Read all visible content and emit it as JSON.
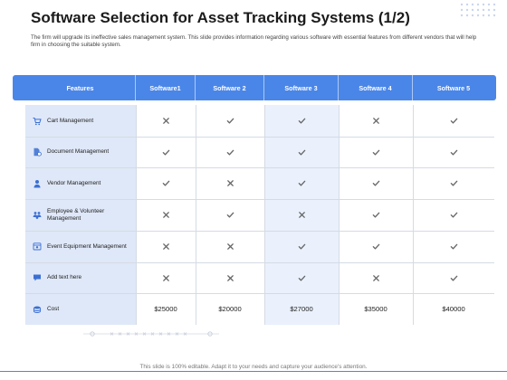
{
  "slide": {
    "title": "Software Selection for Asset Tracking Systems (1/2)",
    "subtitle": "The firm will upgrade its ineffective sales management system. This slide provides information regarding various software with essential features from different vendors that will help firm in choosing the suitable system.",
    "footer": "This slide is 100% editable. Adapt it to your needs and capture your audience's attention."
  },
  "colors": {
    "accent": "#4a86e8",
    "feature_column": "#dfe8f8",
    "highlight_column": "#eaf1fc",
    "check": "#666666",
    "icon": "#3b6fd4"
  },
  "table": {
    "headers": [
      "Features",
      "Software1",
      "Software 2",
      "Software 3",
      "Software 4",
      "Software 5"
    ],
    "rows": [
      {
        "feature": "Cart Management",
        "icon": "cart-icon",
        "marks": [
          "cross",
          "check",
          "check",
          "cross",
          "check"
        ]
      },
      {
        "feature": "Document Management",
        "icon": "document-gear-icon",
        "marks": [
          "check",
          "check",
          "check",
          "check",
          "check"
        ]
      },
      {
        "feature": "Vendor Management",
        "icon": "vendor-icon",
        "marks": [
          "check",
          "cross",
          "check",
          "check",
          "check"
        ]
      },
      {
        "feature": "Employee & Volunteer Management",
        "icon": "people-icon",
        "marks": [
          "cross",
          "check",
          "cross",
          "check",
          "check"
        ]
      },
      {
        "feature": "Event Equipment Management",
        "icon": "event-icon",
        "marks": [
          "cross",
          "cross",
          "check",
          "check",
          "check"
        ]
      },
      {
        "feature": "Add text here",
        "icon": "chat-icon",
        "marks": [
          "cross",
          "cross",
          "check",
          "cross",
          "check"
        ]
      }
    ],
    "cost": {
      "feature": "Cost",
      "icon": "coins-icon",
      "values": [
        "$25000",
        "$20000",
        "$27000",
        "$35000",
        "$40000"
      ]
    }
  }
}
